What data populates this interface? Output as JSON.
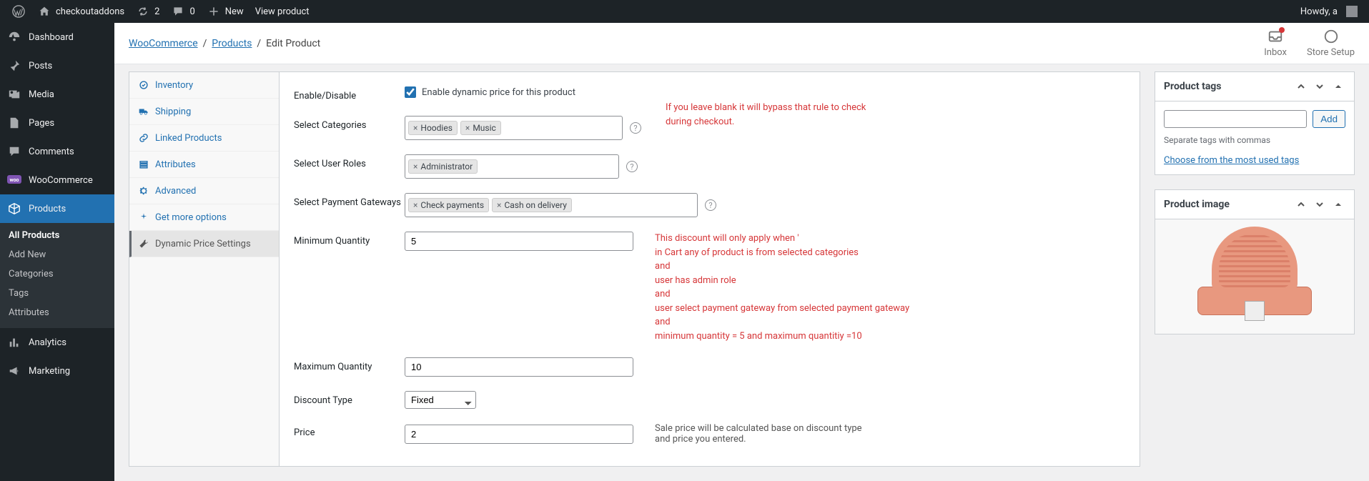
{
  "adminbar": {
    "site": "checkoutaddons",
    "updates": "2",
    "comments": "0",
    "new": "New",
    "view": "View product",
    "howdy": "Howdy, a"
  },
  "menu": {
    "dashboard": "Dashboard",
    "posts": "Posts",
    "media": "Media",
    "pages": "Pages",
    "comments": "Comments",
    "woocommerce": "WooCommerce",
    "products": "Products",
    "products_sub": {
      "all": "All Products",
      "add": "Add New",
      "cats": "Categories",
      "tags": "Tags",
      "attrs": "Attributes"
    },
    "analytics": "Analytics",
    "marketing": "Marketing"
  },
  "breadcrumb": {
    "woo": "WooCommerce",
    "products": "Products",
    "current": "Edit Product"
  },
  "header": {
    "inbox": "Inbox",
    "store": "Store Setup"
  },
  "tabs": {
    "inventory": "Inventory",
    "shipping": "Shipping",
    "linked": "Linked Products",
    "attributes": "Attributes",
    "advanced": "Advanced",
    "getmore": "Get more options",
    "dynamic": "Dynamic Price Settings"
  },
  "form": {
    "enable_lbl": "Enable/Disable",
    "enable_chk": "Enable dynamic price for this product",
    "cats_lbl": "Select Categories",
    "cats": [
      "Hoodies",
      "Music"
    ],
    "roles_lbl": "Select User Roles",
    "roles": [
      "Administrator"
    ],
    "gates_lbl": "Select Payment Gateways",
    "gates": [
      "Check payments",
      "Cash on delivery"
    ],
    "minq_lbl": "Minimum Quantity",
    "minq": "5",
    "maxq_lbl": "Maximum Quantity",
    "maxq": "10",
    "dtype_lbl": "Discount Type",
    "dtype": "Fixed",
    "price_lbl": "Price",
    "price": "2",
    "note_top": "If you leave blank it will bypass that rule to check during checkout.",
    "note_rules_l1": "This discount will only apply when '",
    "note_rules_l2": "in Cart any of product is from selected categories",
    "note_rules_l3": "and",
    "note_rules_l4": "user has admin role",
    "note_rules_l5": "and",
    "note_rules_l6": "user select payment gateway from selected payment gateway",
    "note_rules_l7": "and",
    "note_rules_l8": "minimum quantity = 5 and maximum quantitiy =10",
    "price_note": "Sale price will be calculated base on discount type and price you entered."
  },
  "tagsbox": {
    "title": "Product tags",
    "add": "Add",
    "sep": "Separate tags with commas",
    "choose": "Choose from the most used tags"
  },
  "imgbox": {
    "title": "Product image"
  }
}
